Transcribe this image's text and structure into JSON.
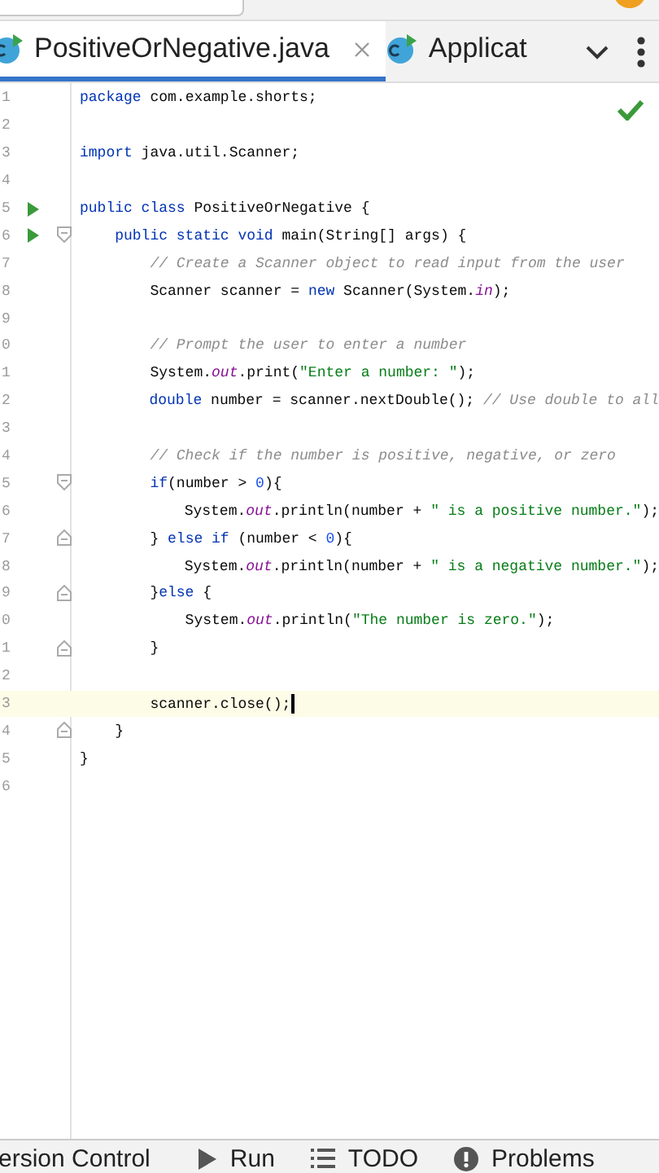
{
  "tabs": [
    {
      "label": "PositiveOrNegative.java",
      "selected": true,
      "closable": true
    },
    {
      "label": "Applicat",
      "selected": false,
      "closable": false
    }
  ],
  "editor": {
    "no_problems": true,
    "lines": [
      {
        "number": "1",
        "run_marker": false,
        "fold_start": false,
        "fold_end": false,
        "current": false,
        "tokens": [
          {
            "kind": "keyword",
            "text": "package"
          },
          {
            "kind": "plain",
            "text": " com.example.shorts;"
          }
        ]
      },
      {
        "number": "2",
        "run_marker": false,
        "fold_start": false,
        "fold_end": false,
        "current": false
      },
      {
        "number": "3",
        "run_marker": false,
        "fold_start": false,
        "fold_end": false,
        "current": false,
        "tokens": [
          {
            "kind": "keyword",
            "text": "import"
          },
          {
            "kind": "plain",
            "text": " java.util.Scanner;"
          }
        ]
      },
      {
        "number": "4",
        "run_marker": false,
        "fold_start": false,
        "fold_end": false,
        "current": false
      },
      {
        "number": "5",
        "run_marker": true,
        "fold_start": false,
        "fold_end": false,
        "current": false,
        "tokens": [
          {
            "kind": "keyword",
            "text": "public class"
          },
          {
            "kind": "plain",
            "text": " PositiveOrNegative {"
          }
        ]
      },
      {
        "number": "6",
        "run_marker": true,
        "fold_start": true,
        "fold_end": false,
        "current": false,
        "tokens": [
          {
            "kind": "keyword",
            "text": "    public static void"
          },
          {
            "kind": "plain",
            "text": " main(String[] args) {"
          }
        ]
      },
      {
        "number": "7",
        "run_marker": false,
        "fold_start": false,
        "fold_end": false,
        "current": false,
        "tokens": [
          {
            "kind": "comment",
            "text": "        // Create a Scanner object to read input from the user"
          }
        ]
      },
      {
        "number": "8",
        "run_marker": false,
        "fold_start": false,
        "fold_end": false,
        "current": false,
        "tokens": [
          {
            "kind": "plain",
            "text": "        Scanner scanner = "
          },
          {
            "kind": "keyword",
            "text": "new"
          },
          {
            "kind": "plain",
            "text": " Scanner(System."
          },
          {
            "kind": "field",
            "text": "in"
          },
          {
            "kind": "plain",
            "text": ");"
          }
        ]
      },
      {
        "number": "9",
        "run_marker": false,
        "fold_start": false,
        "fold_end": false,
        "current": false
      },
      {
        "number": "0",
        "run_marker": false,
        "fold_start": false,
        "fold_end": false,
        "current": false,
        "tokens": [
          {
            "kind": "comment",
            "text": "        // Prompt the user to enter a number"
          }
        ]
      },
      {
        "number": "1",
        "run_marker": false,
        "fold_start": false,
        "fold_end": false,
        "current": false,
        "tokens": [
          {
            "kind": "plain",
            "text": "        System."
          },
          {
            "kind": "field",
            "text": "out"
          },
          {
            "kind": "plain",
            "text": ".print("
          },
          {
            "kind": "string",
            "text": "\"Enter a number: \""
          },
          {
            "kind": "plain",
            "text": ");"
          }
        ]
      },
      {
        "number": "2",
        "run_marker": false,
        "fold_start": false,
        "fold_end": false,
        "current": false,
        "tokens": [
          {
            "kind": "keyword",
            "text": "        double"
          },
          {
            "kind": "plain",
            "text": " number = scanner.nextDouble(); "
          },
          {
            "kind": "comment",
            "text": "// Use double to all"
          }
        ]
      },
      {
        "number": "3",
        "run_marker": false,
        "fold_start": false,
        "fold_end": false,
        "current": false
      },
      {
        "number": "4",
        "run_marker": false,
        "fold_start": false,
        "fold_end": false,
        "current": false,
        "tokens": [
          {
            "kind": "comment",
            "text": "        // Check if the number is positive, negative, or zero"
          }
        ]
      },
      {
        "number": "5",
        "run_marker": false,
        "fold_start": true,
        "fold_end": false,
        "current": false,
        "tokens": [
          {
            "kind": "keyword",
            "text": "        if"
          },
          {
            "kind": "plain",
            "text": "(number > "
          },
          {
            "kind": "number",
            "text": "0"
          },
          {
            "kind": "plain",
            "text": "){"
          }
        ]
      },
      {
        "number": "6",
        "run_marker": false,
        "fold_start": false,
        "fold_end": false,
        "current": false,
        "tokens": [
          {
            "kind": "plain",
            "text": "            System."
          },
          {
            "kind": "field",
            "text": "out"
          },
          {
            "kind": "plain",
            "text": ".println(number + "
          },
          {
            "kind": "string",
            "text": "\" is a positive number.\""
          },
          {
            "kind": "plain",
            "text": ");"
          }
        ]
      },
      {
        "number": "7",
        "run_marker": false,
        "fold_start": false,
        "fold_end": true,
        "current": false,
        "tokens": [
          {
            "kind": "plain",
            "text": "        } "
          },
          {
            "kind": "keyword",
            "text": "else if"
          },
          {
            "kind": "plain",
            "text": " (number < "
          },
          {
            "kind": "number",
            "text": "0"
          },
          {
            "kind": "plain",
            "text": "){"
          }
        ]
      },
      {
        "number": "8",
        "run_marker": false,
        "fold_start": false,
        "fold_end": false,
        "current": false,
        "tokens": [
          {
            "kind": "plain",
            "text": "            System."
          },
          {
            "kind": "field",
            "text": "out"
          },
          {
            "kind": "plain",
            "text": ".println(number + "
          },
          {
            "kind": "string",
            "text": "\" is a negative number.\""
          },
          {
            "kind": "plain",
            "text": ");"
          }
        ]
      },
      {
        "number": "9",
        "run_marker": false,
        "fold_start": false,
        "fold_end": true,
        "current": false,
        "tokens": [
          {
            "kind": "plain",
            "text": "        }"
          },
          {
            "kind": "keyword",
            "text": "else"
          },
          {
            "kind": "plain",
            "text": " {"
          }
        ]
      },
      {
        "number": "0",
        "run_marker": false,
        "fold_start": false,
        "fold_end": false,
        "current": false,
        "tokens": [
          {
            "kind": "plain",
            "text": "            System."
          },
          {
            "kind": "field",
            "text": "out"
          },
          {
            "kind": "plain",
            "text": ".println("
          },
          {
            "kind": "string",
            "text": "\"The number is zero.\""
          },
          {
            "kind": "plain",
            "text": ");"
          }
        ]
      },
      {
        "number": "1",
        "run_marker": false,
        "fold_start": false,
        "fold_end": true,
        "current": false,
        "tokens": [
          {
            "kind": "plain",
            "text": "        }"
          }
        ]
      },
      {
        "number": "2",
        "run_marker": false,
        "fold_start": false,
        "fold_end": false,
        "current": false
      },
      {
        "number": "3",
        "run_marker": false,
        "fold_start": false,
        "fold_end": false,
        "current": true,
        "tokens": [
          {
            "kind": "plain",
            "text": "        scanner.close();"
          }
        ]
      },
      {
        "number": "4",
        "run_marker": false,
        "fold_start": false,
        "fold_end": true,
        "current": false,
        "tokens": [
          {
            "kind": "plain",
            "text": "    }"
          }
        ]
      },
      {
        "number": "5",
        "run_marker": false,
        "fold_start": false,
        "fold_end": false,
        "current": false,
        "tokens": [
          {
            "kind": "plain",
            "text": "}"
          }
        ]
      },
      {
        "number": "6",
        "run_marker": false,
        "fold_start": false,
        "fold_end": false,
        "current": false
      }
    ]
  },
  "tool_windows": [
    {
      "kind": "vcs",
      "label": "ersion Control"
    },
    {
      "kind": "run",
      "label": "Run"
    },
    {
      "kind": "todo",
      "label": "TODO"
    },
    {
      "kind": "problems",
      "label": "Problems"
    }
  ]
}
